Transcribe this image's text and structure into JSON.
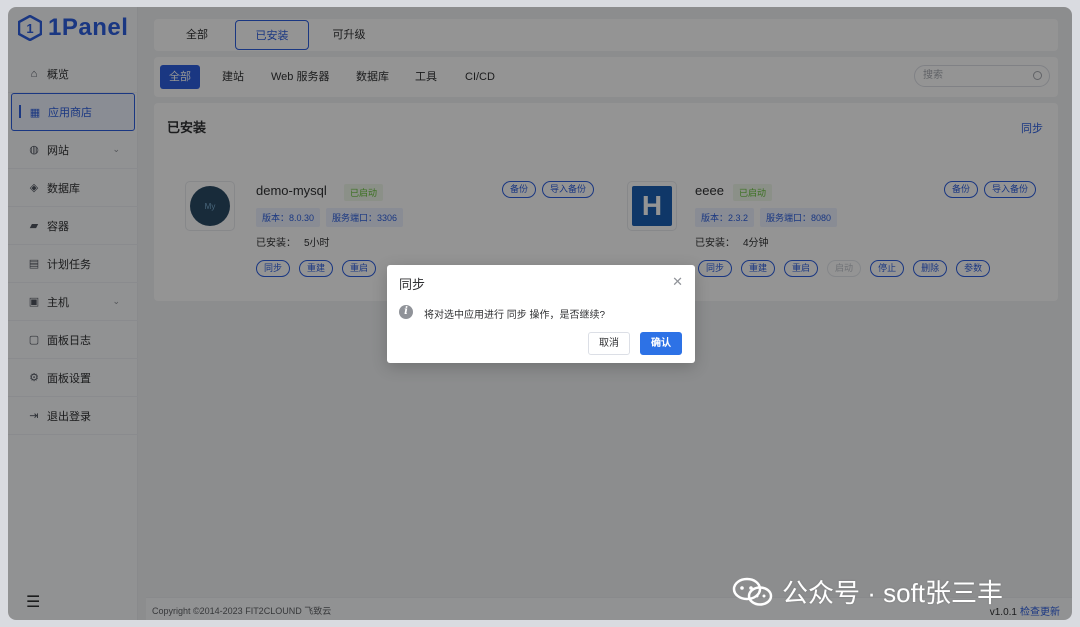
{
  "brand": {
    "name": "1Panel"
  },
  "sidebar": {
    "items": [
      {
        "label": "概览",
        "icon": "home-icon"
      },
      {
        "label": "应用商店",
        "icon": "app-store-icon"
      },
      {
        "label": "网站",
        "icon": "globe-icon"
      },
      {
        "label": "数据库",
        "icon": "database-icon"
      },
      {
        "label": "容器",
        "icon": "docker-icon"
      },
      {
        "label": "计划任务",
        "icon": "cron-icon"
      },
      {
        "label": "主机",
        "icon": "host-icon"
      },
      {
        "label": "面板日志",
        "icon": "log-icon"
      },
      {
        "label": "面板设置",
        "icon": "gear-icon"
      },
      {
        "label": "退出登录",
        "icon": "logout-icon"
      }
    ]
  },
  "top_tabs": [
    "全部",
    "已安装",
    "可升级"
  ],
  "filters": [
    "全部",
    "建站",
    "Web 服务器",
    "数据库",
    "工具",
    "CI/CD"
  ],
  "search": {
    "placeholder": "搜索"
  },
  "panel": {
    "title": "已安装",
    "sync": "同步"
  },
  "apps": [
    {
      "name": "demo-mysql",
      "status": "已启动",
      "version": "版本：8.0.30",
      "port": "服务端口：3306",
      "installed_label": "已安装：",
      "installed_time": "5小时",
      "top_actions": [
        "备份",
        "导入备份"
      ],
      "actions": [
        "同步",
        "重建",
        "重启"
      ]
    },
    {
      "name": "eeee",
      "status": "已启动",
      "version": "版本：2.3.2",
      "port": "服务端口：8080",
      "installed_label": "已安装：",
      "installed_time": "4分钟",
      "top_actions": [
        "备份",
        "导入备份"
      ],
      "actions": [
        "同步",
        "重建",
        "重启",
        "启动",
        "停止",
        "删除",
        "参数"
      ]
    }
  ],
  "dialog": {
    "title": "同步",
    "message": "将对选中应用进行 同步 操作，是否继续?",
    "cancel": "取消",
    "confirm": "确认"
  },
  "footer": {
    "copyright": "Copyright ©2014-2023 FIT2CLOUND 飞致云",
    "version": "v1.0.1",
    "update": "检查更新"
  },
  "watermark": "公众号 · soft张三丰",
  "colors": {
    "primary": "#2d5fe0",
    "success": "#67c23a",
    "overlay": "rgba(0,0,0,0.42)"
  }
}
